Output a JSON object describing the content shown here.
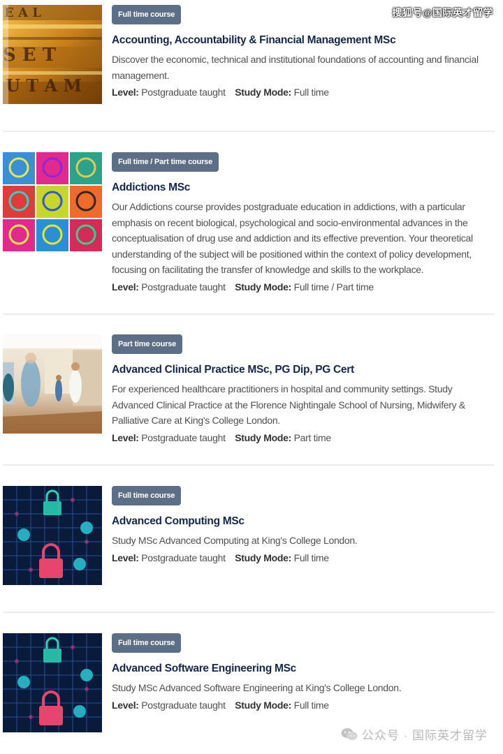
{
  "watermark": {
    "top": "搜狐号@国际英才留学",
    "bottom": "公众号 · 国际英才留学"
  },
  "meta_labels": {
    "level": "Level:",
    "study_mode": "Study Mode:"
  },
  "colors": {
    "badge_bg": "#5d6f86",
    "title": "#16284a",
    "divider": "#ececec"
  },
  "courses": [
    {
      "badge": "Full time course",
      "title": "Accounting, Accountability & Financial Management MSc",
      "description": "Discover the economic, technical and institutional foundations of accounting and financial management.",
      "level": "Postgraduate taught",
      "study_mode": "Full time",
      "image": "gold-coins-image"
    },
    {
      "badge": "Full time / Part time course",
      "title": "Addictions MSc",
      "description": "Our Addictions course provides postgraduate education in addictions, with a particular emphasis on recent biological, psychological and socio-environmental advances in the conceptualisation of drug use and addiction and its effective prevention. Your theoretical understanding of the subject will be positioned within the context of policy development, focusing on facilitating the transfer of knowledge and skills to the workplace.",
      "level": "Postgraduate taught",
      "study_mode": "Full time / Part time",
      "image": "brain-scans-image"
    },
    {
      "badge": "Part time course",
      "title": "Advanced Clinical Practice MSc, PG Dip, PG Cert",
      "description": "For experienced healthcare practitioners in hospital and community settings. Study Advanced Clinical Practice at the Florence Nightingale School of Nursing, Midwifery & Palliative Care at King's College London.",
      "level": "Postgraduate taught",
      "study_mode": "Part time",
      "image": "hospital-corridor-image"
    },
    {
      "badge": "Full time course",
      "title": "Advanced Computing MSc",
      "description": "Study MSc Advanced Computing at King's College London.",
      "level": "Postgraduate taught",
      "study_mode": "Full time",
      "image": "cyber-lock-image"
    },
    {
      "badge": "Full time course",
      "title": "Advanced Software Engineering MSc",
      "description": "Study MSc Advanced Software Engineering at King's College London.",
      "level": "Postgraduate taught",
      "study_mode": "Full time",
      "image": "cyber-lock-image"
    }
  ]
}
